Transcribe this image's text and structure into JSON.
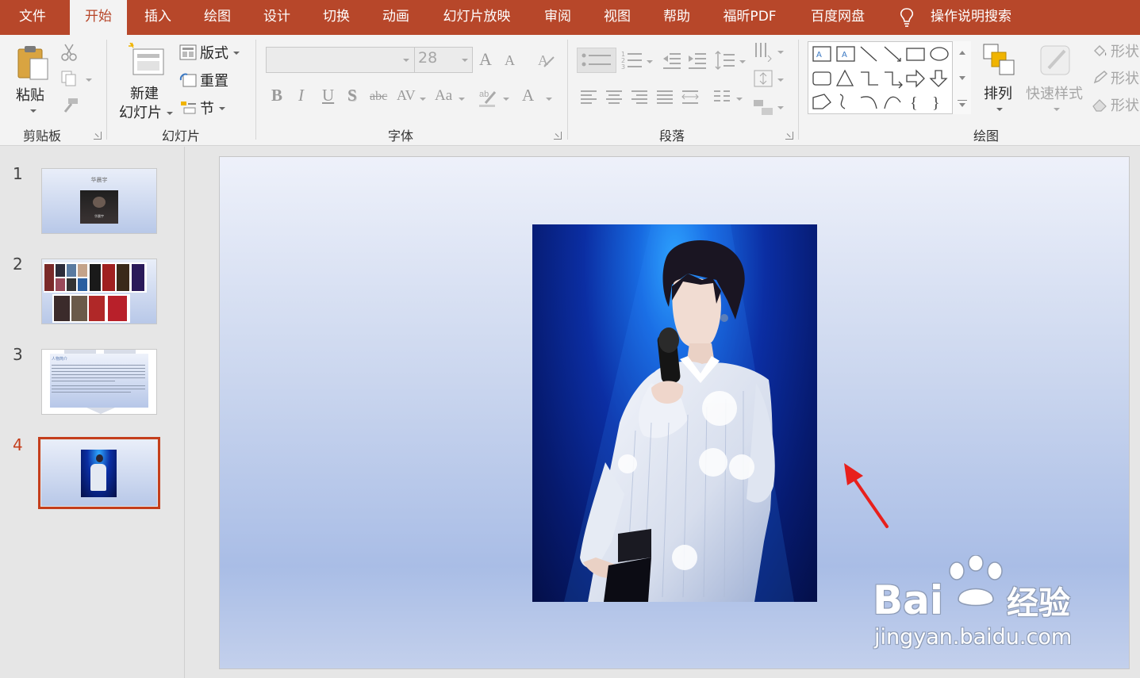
{
  "menu": {
    "tabs": [
      {
        "label": "文件"
      },
      {
        "label": "开始"
      },
      {
        "label": "插入"
      },
      {
        "label": "绘图"
      },
      {
        "label": "设计"
      },
      {
        "label": "切换"
      },
      {
        "label": "动画"
      },
      {
        "label": "幻灯片放映"
      },
      {
        "label": "审阅"
      },
      {
        "label": "视图"
      },
      {
        "label": "帮助"
      },
      {
        "label": "福昕PDF"
      },
      {
        "label": "百度网盘"
      }
    ],
    "active_tab": "开始",
    "tell_me": "操作说明搜索"
  },
  "ribbon": {
    "clipboard": {
      "paste": "粘贴",
      "label": "剪贴板"
    },
    "slides": {
      "new_slide_line1": "新建",
      "new_slide_line2": "幻灯片",
      "layout": "版式",
      "reset": "重置",
      "section": "节",
      "label": "幻灯片"
    },
    "font": {
      "font_size": "28",
      "label": "字体",
      "bold": "B",
      "italic": "I",
      "underline": "U",
      "shadow": "S",
      "strike": "abc",
      "spacing": "AV",
      "case": "Aa",
      "font_color": "A",
      "grow": "A",
      "shrink": "A"
    },
    "paragraph": {
      "label": "段落"
    },
    "drawing": {
      "arrange": "排列",
      "quick_styles": "快速样式",
      "shape_fill": "形状",
      "shape_outline": "形状",
      "shape_effects": "形状",
      "label": "绘图"
    }
  },
  "thumbnails": [
    {
      "number": "1",
      "title": "华晨宇",
      "subtitle": "华晨宇"
    },
    {
      "number": "2"
    },
    {
      "number": "3",
      "heading": "人物简介"
    },
    {
      "number": "4"
    }
  ],
  "selected_slide": "4",
  "watermark": {
    "brand": "Bai",
    "brand_cn": "经验",
    "url": "jingyan.baidu.com"
  },
  "colors": {
    "accent": "#b7472a",
    "selection": "#c43e1c",
    "annotation_arrow": "#e8201c"
  }
}
